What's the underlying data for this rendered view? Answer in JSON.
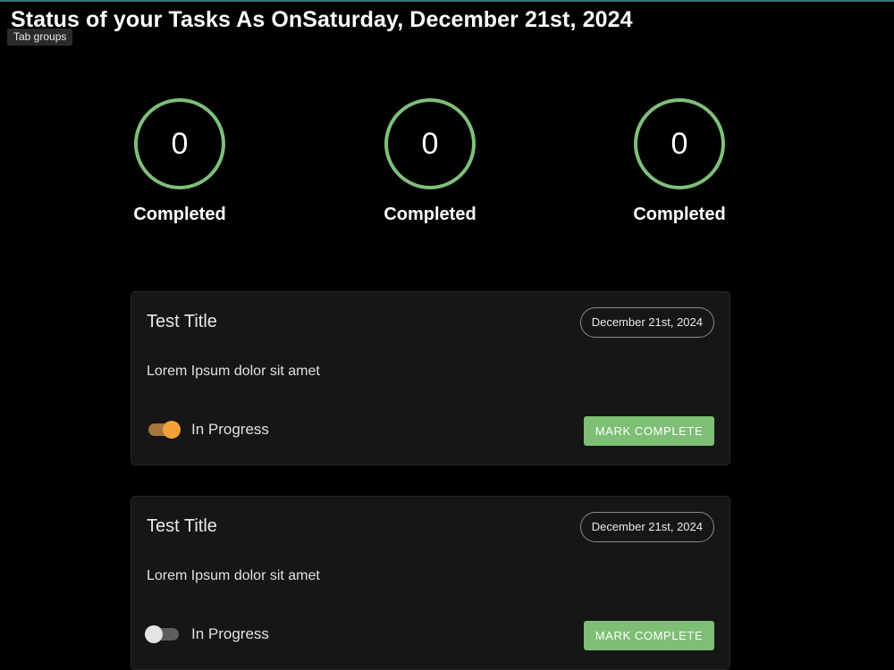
{
  "header": {
    "title": "Status of your Tasks As OnSaturday, December 21st, 2024",
    "tooltip": "Tab groups"
  },
  "stats": [
    {
      "value": "0",
      "label": "Completed"
    },
    {
      "value": "0",
      "label": "Completed"
    },
    {
      "value": "0",
      "label": "Completed"
    }
  ],
  "tasks": [
    {
      "title": "Test Title",
      "date": "December 21st, 2024",
      "description": "Lorem Ipsum dolor sit amet",
      "status_label": "In Progress",
      "in_progress": true,
      "button_label": "MARK COMPLETE"
    },
    {
      "title": "Test Title",
      "date": "December 21st, 2024",
      "description": "Lorem Ipsum dolor sit amet",
      "status_label": "In Progress",
      "in_progress": false,
      "button_label": "MARK COMPLETE"
    }
  ],
  "colors": {
    "ring": "#7fbf7a",
    "button": "#7dbf74",
    "toggle_on": "#f3a23a",
    "toggle_off": "#e4e4e4"
  }
}
